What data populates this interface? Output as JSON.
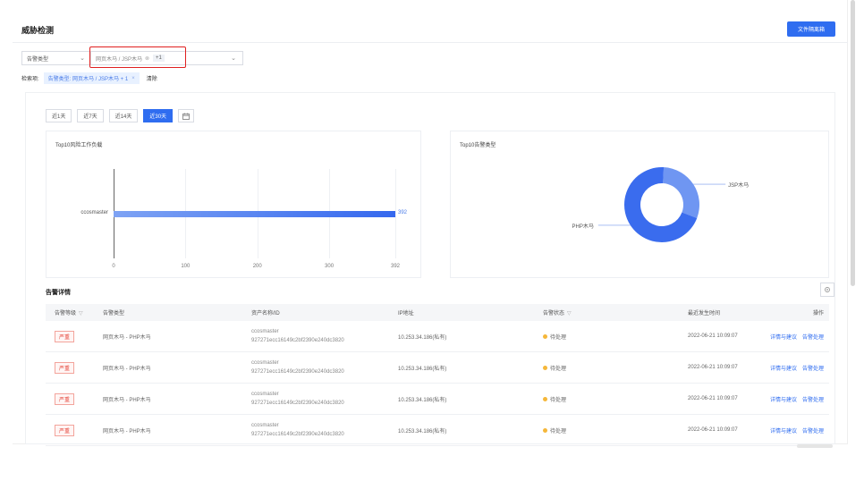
{
  "page": {
    "title": "威胁检测",
    "export_label": "文件隔离箱"
  },
  "filters": {
    "type_select": {
      "value": "告警类型"
    },
    "value_select": {
      "tag": "网页木马 / JSP木马",
      "more": "+1"
    },
    "search_label": "检索项:",
    "chip_text": "告警类型: 网页木马 / JSP木马 + 1",
    "clear_label": "清除"
  },
  "date_range": {
    "buttons": [
      "近1天",
      "近7天",
      "近14天",
      "近30天"
    ],
    "active": "近30天"
  },
  "bar_chart_title": "Top10风险工作负载",
  "pie_chart_title": "Top10告警类型",
  "chart_data": [
    {
      "type": "bar",
      "orientation": "horizontal",
      "title": "Top10风险工作负载",
      "categories": [
        "ccosmaster"
      ],
      "values": [
        392
      ],
      "xlim": [
        0,
        392
      ],
      "x_ticks": [
        "0",
        "100",
        "200",
        "300",
        "392"
      ],
      "colors": [
        "#3568ee"
      ]
    },
    {
      "type": "pie",
      "style": "donut",
      "title": "Top10告警类型",
      "labels": [
        "JSP木马",
        "PHP木马"
      ],
      "values": [
        0.3,
        0.7
      ],
      "colors": [
        "#6f96f2",
        "#3a6cee"
      ]
    }
  ],
  "alerts": {
    "title": "告警详情",
    "columns": [
      "告警等级",
      "告警类型",
      "资产名称/ID",
      "IP地址",
      "告警状态",
      "最近发生时间",
      "操作"
    ],
    "rows": [
      {
        "level": "严重",
        "type": "网页木马 - PHP木马",
        "asset_name": "ccosmaster",
        "asset_id": "927271ecc16149c2bf2390e240dc3820",
        "ip": "10.253.34.186(私有)",
        "status": "待处理",
        "time": "2022-06-21 10:09:07",
        "op_detail": "详情与建议",
        "op_handle": "告警处理"
      },
      {
        "level": "严重",
        "type": "网页木马 - PHP木马",
        "asset_name": "ccosmaster",
        "asset_id": "927271ecc16149c2bf2390e240dc3820",
        "ip": "10.253.34.186(私有)",
        "status": "待处理",
        "time": "2022-06-21 10:09:07",
        "op_detail": "详情与建议",
        "op_handle": "告警处理"
      },
      {
        "level": "严重",
        "type": "网页木马 - PHP木马",
        "asset_name": "ccosmaster",
        "asset_id": "927271ecc16149c2bf2390e240dc3820",
        "ip": "10.253.34.186(私有)",
        "status": "待处理",
        "time": "2022-06-21 10:09:07",
        "op_detail": "详情与建议",
        "op_handle": "告警处理"
      },
      {
        "level": "严重",
        "type": "网页木马 - PHP木马",
        "asset_name": "ccosmaster",
        "asset_id": "927271ecc16149c2bf2390e240dc3820",
        "ip": "10.253.34.186(私有)",
        "status": "待处理",
        "time": "2022-06-21 10:09:07",
        "op_detail": "详情与建议",
        "op_handle": "告警处理"
      }
    ]
  }
}
